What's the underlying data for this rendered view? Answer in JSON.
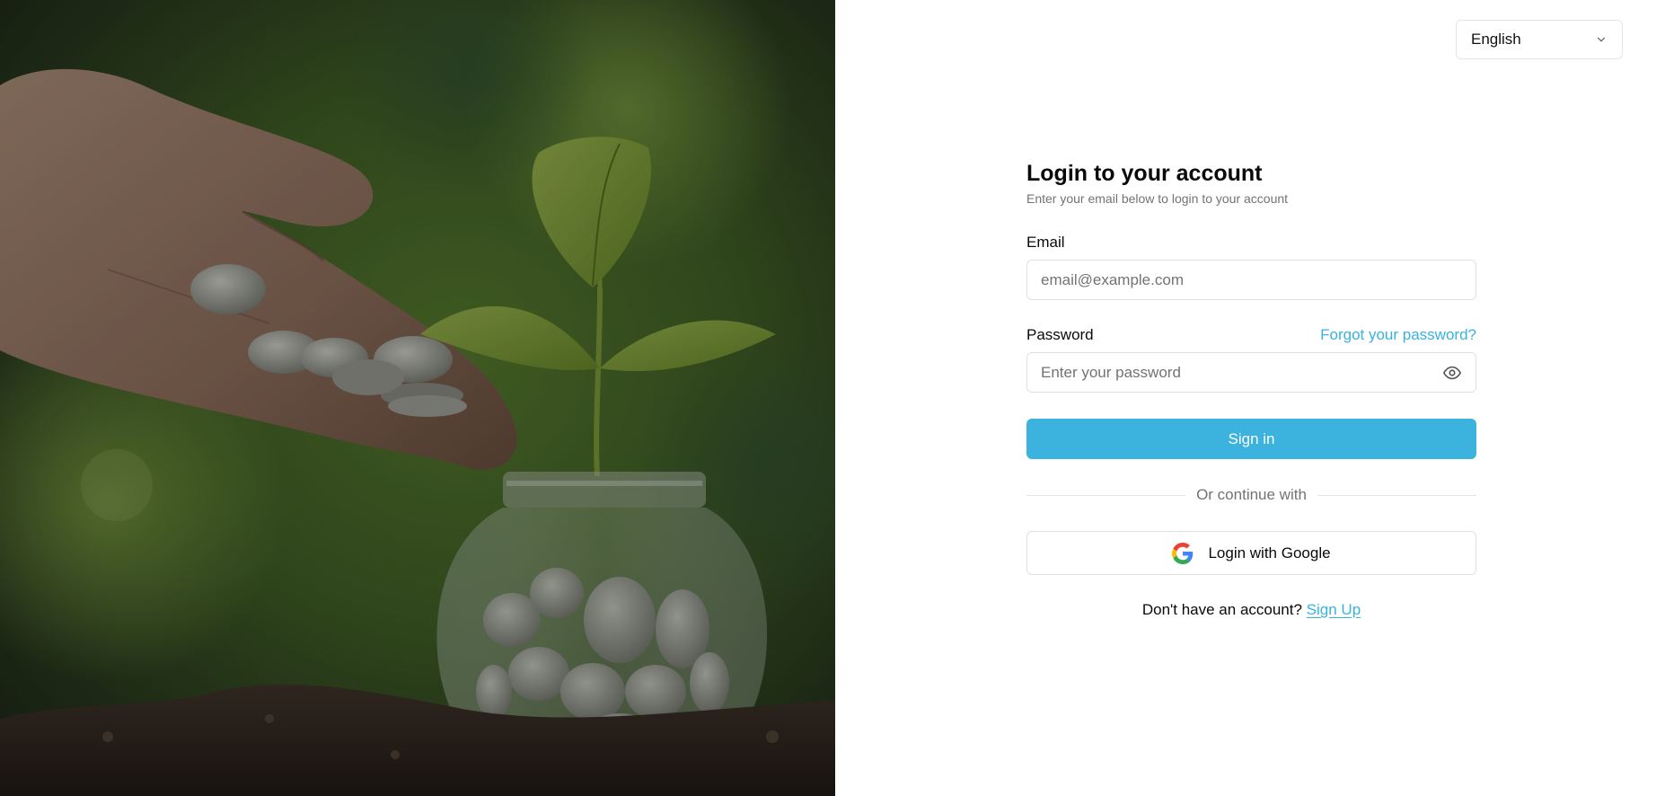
{
  "language": {
    "selected": "English",
    "icon": "chevron-down-icon"
  },
  "login": {
    "title": "Login to your account",
    "subtitle": "Enter your email below to login to your account",
    "email_label": "Email",
    "email_placeholder": "email@example.com",
    "password_label": "Password",
    "forgot_label": "Forgot your password?",
    "password_placeholder": "Enter your password",
    "password_toggle_icon": "eye-icon",
    "signin_label": "Sign in",
    "divider_label": "Or continue with",
    "google_label": "Login with Google",
    "google_icon": "google-icon",
    "signup_prompt": "Don't have an account?",
    "signup_label": "Sign Up"
  },
  "colors": {
    "accent": "#3bb3de",
    "link": "#38b2de",
    "muted_text": "#737373",
    "border": "#e0e0e0"
  },
  "hero": {
    "image": "hand-dropping-coins-into-jar-with-plant-sprout"
  }
}
